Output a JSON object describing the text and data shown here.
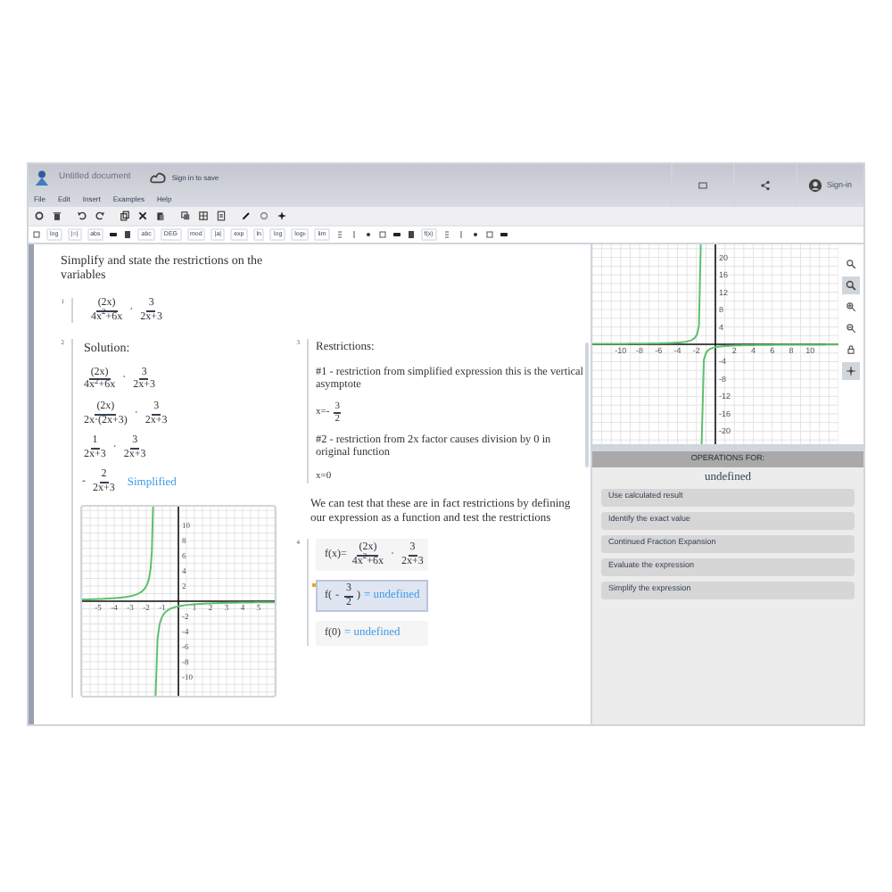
{
  "header": {
    "title": "Untitled document",
    "save_link": "Sign in to save",
    "sign_in": "Sign-in"
  },
  "menu": [
    "File",
    "Edit",
    "Insert",
    "Examples",
    "Help"
  ],
  "toolbar2": [
    {
      "kind": "icon"
    },
    {
      "kind": "text",
      "text": "log"
    },
    {
      "kind": "text",
      "text": "|○|"
    },
    {
      "kind": "text",
      "text": "abs"
    },
    {
      "kind": "icon"
    },
    {
      "kind": "icon"
    },
    {
      "kind": "text",
      "text": "abc"
    },
    {
      "kind": "text",
      "text": "DEG"
    },
    {
      "kind": "text",
      "text": "mod"
    },
    {
      "kind": "text",
      "text": "|a|"
    },
    {
      "kind": "text",
      "text": "exp"
    },
    {
      "kind": "text",
      "text": "ln"
    },
    {
      "kind": "text",
      "text": "log"
    },
    {
      "kind": "text",
      "text": "log$_{b}$"
    },
    {
      "kind": "text",
      "text": "lim"
    },
    {
      "kind": "icon"
    },
    {
      "kind": "icon"
    },
    {
      "kind": "icon"
    },
    {
      "kind": "icon"
    },
    {
      "kind": "icon"
    },
    {
      "kind": "icon"
    },
    {
      "kind": "text",
      "text": "f(x)"
    },
    {
      "kind": "icon"
    },
    {
      "kind": "icon"
    },
    {
      "kind": "icon"
    },
    {
      "kind": "icon"
    },
    {
      "kind": "icon"
    }
  ],
  "intro": "Simplify and state the restrictions on the variables",
  "cell1": {
    "number": "1",
    "line": [
      {
        "kind": "frac",
        "num": "(2x)",
        "den": "4x$^{2}$+6x"
      },
      {
        "kind": "op",
        "text": "·"
      },
      {
        "kind": "frac",
        "num": "3",
        "den": "2x+3"
      }
    ]
  },
  "cell2": {
    "number": "2",
    "heading": "Solution:",
    "lines": [
      [
        {
          "kind": "frac",
          "num": "(2x)",
          "den": "4x$^{2}$+6x"
        },
        {
          "kind": "op",
          "text": "·"
        },
        {
          "kind": "frac",
          "num": "3",
          "den": "2x+3"
        }
      ],
      [
        {
          "kind": "frac",
          "num": "(2x)",
          "den": "2x·(2x+3)"
        },
        {
          "kind": "op",
          "text": "·"
        },
        {
          "kind": "frac",
          "num": "3",
          "den": "2x+3"
        }
      ],
      [
        {
          "kind": "frac",
          "num": "1",
          "den": "2x+3"
        },
        {
          "kind": "op",
          "text": "·"
        },
        {
          "kind": "frac",
          "num": "3",
          "den": "2x+3"
        }
      ],
      [
        {
          "kind": "op",
          "text": "-"
        },
        {
          "kind": "frac",
          "num": "2",
          "den": "2x+3"
        }
      ]
    ],
    "tag": "Simplified",
    "graph": {
      "x_labels": [
        "-5",
        "-4",
        "-3",
        "-2",
        "-1",
        "1",
        "2",
        "3",
        "4",
        "5"
      ],
      "y_labels": [
        "10",
        "8",
        "6",
        "4",
        "2",
        "-2",
        "-4",
        "-6",
        "-8",
        "-10"
      ]
    }
  },
  "cell3": {
    "number": "3",
    "heading": "Restrictions:",
    "items": [
      {
        "kind": "text",
        "text": "#1 - restriction from simplified expression this is the vertical asymptote"
      },
      {
        "kind": "math",
        "line": [
          {
            "kind": "text",
            "text": "x=-"
          },
          {
            "kind": "frac",
            "num": "3",
            "den": "2"
          }
        ]
      },
      {
        "kind": "text",
        "text": "#2 - restriction from 2x factor causes division by 0 in original function"
      },
      {
        "kind": "math",
        "line": [
          {
            "kind": "text",
            "text": "x=0"
          }
        ]
      }
    ]
  },
  "note": "We can test that these are in fact restrictions by defining our expression as a function and test the restrictions",
  "cell4": {
    "number": "4",
    "rows": [
      {
        "selected": false,
        "line": [
          {
            "kind": "text",
            "text": "f(x)="
          },
          {
            "kind": "frac",
            "num": "(2x)",
            "den": "4x$^{2}$+6x"
          },
          {
            "kind": "op",
            "text": "·"
          },
          {
            "kind": "frac",
            "num": "3",
            "den": "2x+3"
          }
        ]
      },
      {
        "selected": true,
        "line": [
          {
            "kind": "text",
            "text": "f("
          },
          {
            "kind": "op",
            "text": "-"
          },
          {
            "kind": "frac",
            "num": "3",
            "den": "2"
          },
          {
            "kind": "text",
            "text": ")"
          }
        ],
        "result": "= undefined"
      },
      {
        "selected": false,
        "line": [
          {
            "kind": "text",
            "text": "f(0)"
          }
        ],
        "result": "= undefined"
      }
    ]
  },
  "graph_panel": {
    "x_labels": [
      "-10",
      "-8",
      "-6",
      "-4",
      "-2",
      "2",
      "4",
      "6",
      "8",
      "10"
    ],
    "y_labels": [
      "20",
      "16",
      "12",
      "8",
      "4",
      "-4",
      "-8",
      "-12",
      "-16",
      "-20"
    ],
    "tools": [
      {
        "selected": false
      },
      {
        "selected": true
      },
      {
        "selected": false
      },
      {
        "selected": false
      },
      {
        "selected": false
      },
      {
        "selected": true
      }
    ]
  },
  "operations": {
    "heading": "OPERATIONS FOR:",
    "subject": "undefined",
    "items": [
      "Use calculated result",
      "Identify the exact value",
      "Continued Fraction Expansion",
      "Evaluate the expression",
      "Simplify the expression"
    ]
  }
}
